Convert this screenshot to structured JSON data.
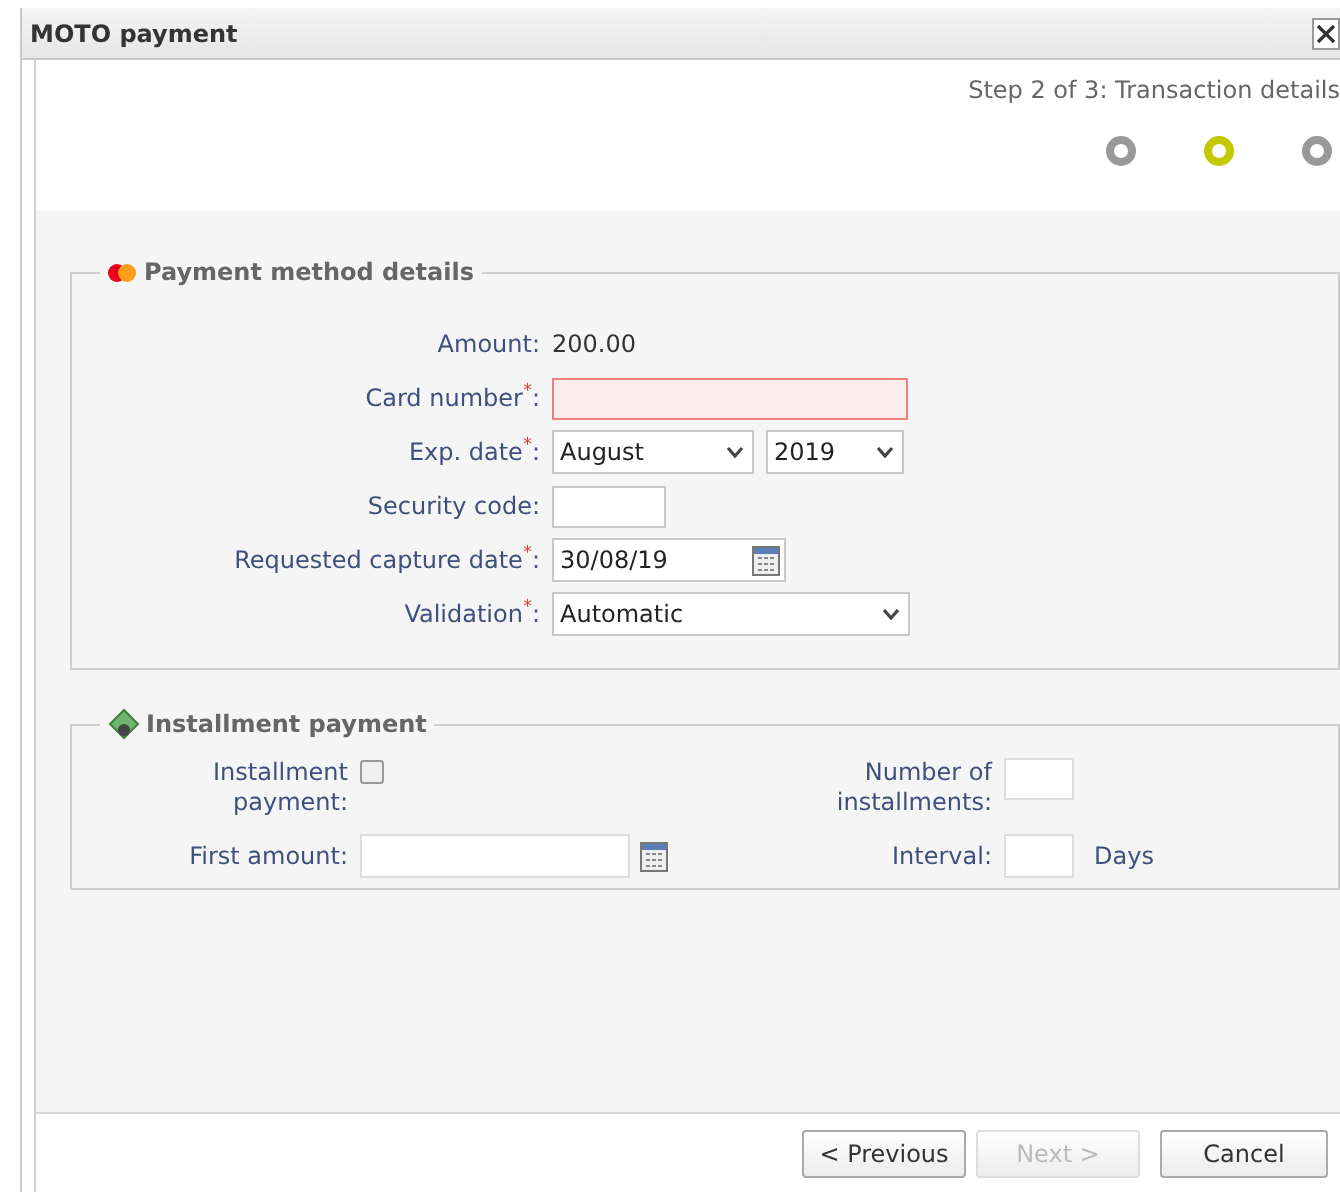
{
  "window": {
    "title": "MOTO payment"
  },
  "step_label": "Step 2 of 3: Transaction details",
  "steps": [
    {
      "selected": false
    },
    {
      "selected": true
    },
    {
      "selected": false
    }
  ],
  "payment_section": {
    "legend": "Payment method details",
    "fields": [
      {
        "kind": "text",
        "label": "Amount",
        "required": false,
        "value": "200.00"
      },
      {
        "kind": "input",
        "label": "Card number",
        "required": true,
        "invalid": true
      },
      {
        "kind": "selects",
        "label": "Exp. date",
        "required": true,
        "options": [
          {
            "value": "August"
          },
          {
            "value": "2019"
          }
        ]
      },
      {
        "kind": "input",
        "label": "Security code",
        "required": false,
        "invalid": false
      },
      {
        "kind": "date",
        "label": "Requested capture date",
        "required": true,
        "value": "30/08/19"
      },
      {
        "kind": "select",
        "label": "Validation",
        "required": true,
        "value": "Automatic"
      }
    ]
  },
  "required_mark": "*",
  "label_suffix": ":",
  "installment_section": {
    "legend": "Installment payment",
    "installment_checkbox": {
      "label": "Installment payment:",
      "checked": false
    },
    "number_of_installments": {
      "label": "Number of installments:"
    },
    "first_amount": {
      "label": "First amount:"
    },
    "interval": {
      "label": "Interval:",
      "unit": "Days"
    }
  },
  "buttons": [
    {
      "label": "< Previous",
      "disabled": false
    },
    {
      "label": "Next >",
      "disabled": true
    },
    {
      "label": "Cancel",
      "disabled": false
    }
  ]
}
